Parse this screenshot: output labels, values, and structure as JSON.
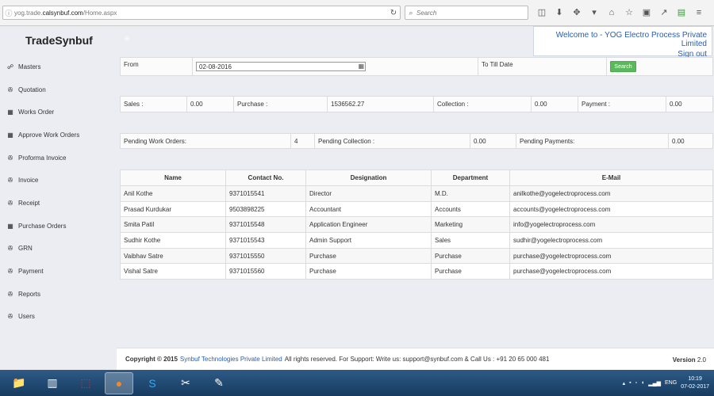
{
  "browser": {
    "url_prefix": "yog.trade.",
    "url_domain": "calsynbuf.com",
    "url_path": "/Home.aspx",
    "search_placeholder": "Search"
  },
  "app": {
    "brand": "TradeSynbuf",
    "welcome_line1": "Welcome to - YOG Electro Process Private Limited",
    "sign_out": "Sign out"
  },
  "sidebar": {
    "items": [
      {
        "label": "Masters",
        "icon": "☍"
      },
      {
        "label": "Quotation",
        "icon": "✇"
      },
      {
        "label": "Works Order",
        "icon": "▦"
      },
      {
        "label": "Approve Work Orders",
        "icon": "▦"
      },
      {
        "label": "Proforma Invoice",
        "icon": "✇"
      },
      {
        "label": "Invoice",
        "icon": "✇"
      },
      {
        "label": "Receipt",
        "icon": "✇"
      },
      {
        "label": "Purchase Orders",
        "icon": "▦"
      },
      {
        "label": "GRN",
        "icon": "✇"
      },
      {
        "label": "Payment",
        "icon": "✇"
      },
      {
        "label": "Reports",
        "icon": "✇"
      },
      {
        "label": "Users",
        "icon": "✇"
      }
    ]
  },
  "filter": {
    "from_label": "From",
    "from_value": "02-08-2016",
    "to_label": "To Till Date",
    "search_button": "Search"
  },
  "summary": {
    "sales_label": "Sales :",
    "sales_value": "0.00",
    "purchase_label": "Purchase :",
    "purchase_value": "1536562.27",
    "collection_label": "Collection :",
    "collection_value": "0.00",
    "payment_label": "Payment :",
    "payment_value": "0.00"
  },
  "pending": {
    "wo_label": "Pending Work Orders:",
    "wo_value": "4",
    "collection_label": "Pending Collection :",
    "collection_value": "0.00",
    "payments_label": "Pending Payments:",
    "payments_value": "0.00"
  },
  "table": {
    "headers": [
      "Name",
      "Contact No.",
      "Designation",
      "Department",
      "E-Mail"
    ],
    "rows": [
      [
        "Anil Kothe",
        "9371015541",
        "Director",
        "M.D.",
        "anilkothe@yogelectroprocess.com"
      ],
      [
        "Prasad Kurdukar",
        "9503898225",
        "Accountant",
        "Accounts",
        "accounts@yogelectroprocess.com"
      ],
      [
        "Smita Patil",
        "9371015548",
        "Application Engineer",
        "Marketing",
        "info@yogelectroprocess.com"
      ],
      [
        "Sudhir Kothe",
        "9371015543",
        "Admin Support",
        "Sales",
        "sudhir@yogelectroprocess.com"
      ],
      [
        "Vaibhav Satre",
        "9371015550",
        "Purchase",
        "Purchase",
        "purchase@yogelectroprocess.com"
      ],
      [
        "Vishal Satre",
        "9371015560",
        "Purchase",
        "Purchase",
        "purchase@yogelectroprocess.com"
      ]
    ]
  },
  "footer": {
    "copyright": "Copyright © 2015",
    "company": "Synbuf Technologies Private Limited",
    "rest": "All rights reserved. For Support: Write us: support@synbuf.com & Call Us : +91 20 65 000 481",
    "version_label": "Version",
    "version_value": "2.0"
  },
  "taskbar": {
    "lang": "ENG",
    "time": "10:19",
    "date": "07-02-2017"
  }
}
